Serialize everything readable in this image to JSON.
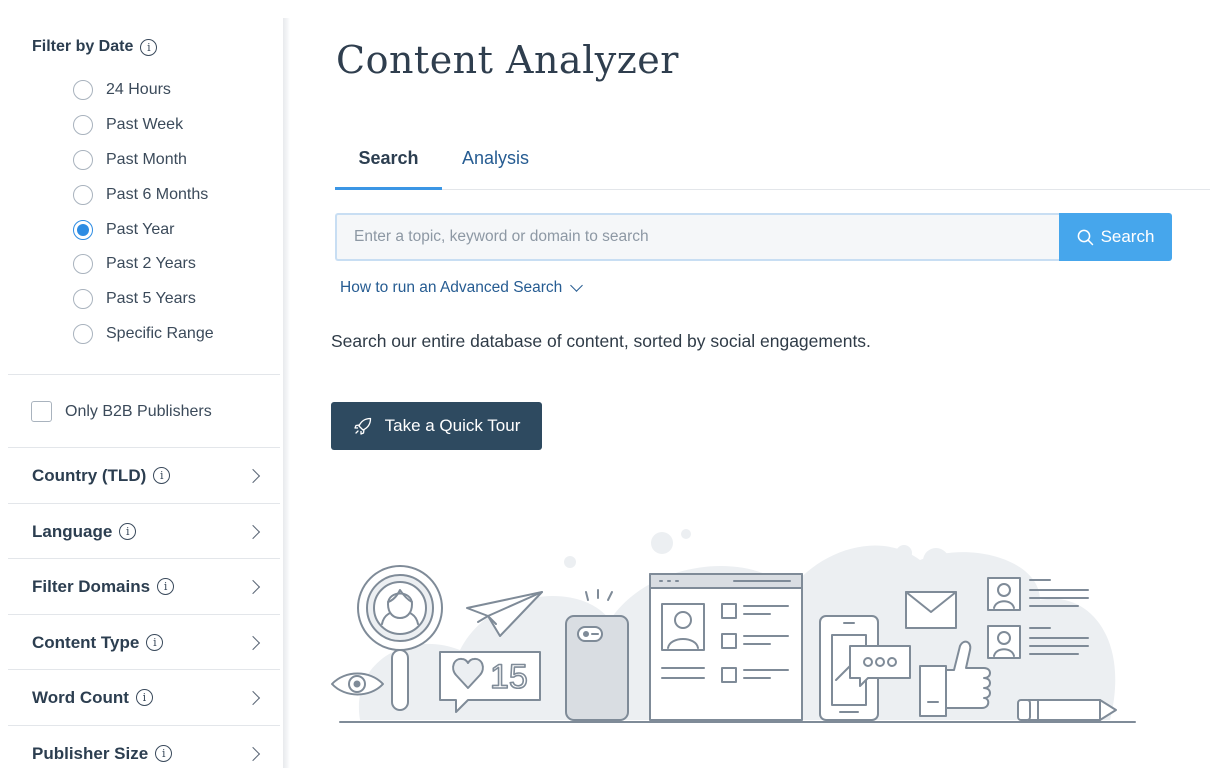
{
  "sidebar": {
    "date_filter": {
      "title": "Filter by Date",
      "options": [
        {
          "label": "24 Hours",
          "checked": false
        },
        {
          "label": "Past Week",
          "checked": false
        },
        {
          "label": "Past Month",
          "checked": false
        },
        {
          "label": "Past 6 Months",
          "checked": false
        },
        {
          "label": "Past Year",
          "checked": true
        },
        {
          "label": "Past 2 Years",
          "checked": false
        },
        {
          "label": "Past 5 Years",
          "checked": false
        },
        {
          "label": "Specific Range",
          "checked": false
        }
      ]
    },
    "b2b_label": "Only B2B Publishers",
    "b2b_checked": false,
    "filters": [
      {
        "label": "Country (TLD)"
      },
      {
        "label": "Language"
      },
      {
        "label": "Filter Domains"
      },
      {
        "label": "Content Type"
      },
      {
        "label": "Word Count"
      },
      {
        "label": "Publisher Size"
      }
    ]
  },
  "main": {
    "title": "Content Analyzer",
    "tabs": [
      {
        "label": "Search",
        "active": true
      },
      {
        "label": "Analysis",
        "active": false
      }
    ],
    "search": {
      "placeholder": "Enter a topic, keyword or domain to search",
      "value": "",
      "button_label": "Search"
    },
    "advanced_link": "How to run an Advanced Search",
    "description": "Search our entire database of content, sorted by social engagements.",
    "tour_button": "Take a Quick Tour",
    "illustration": {
      "like_count": "15"
    }
  },
  "colors": {
    "accent": "#46a6ec",
    "dark_button": "#2e4a60",
    "link": "#265c92",
    "illustration_stroke": "#7f8b98",
    "illustration_fill": "#eceff2"
  }
}
